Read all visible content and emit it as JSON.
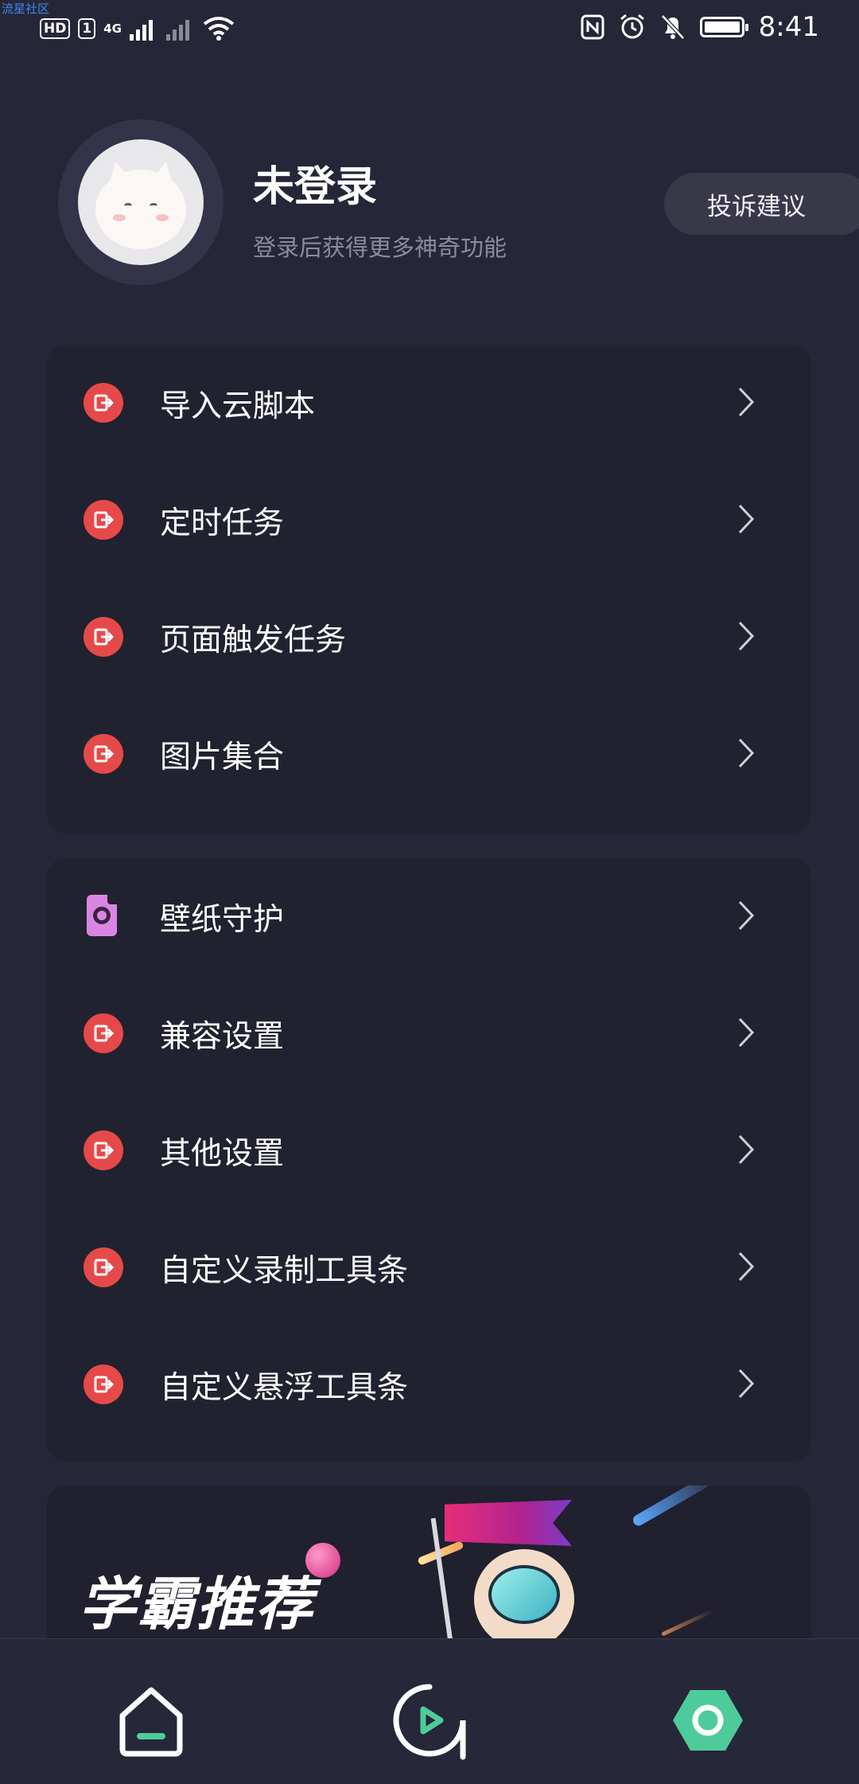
{
  "watermark": "流星社区",
  "status_bar": {
    "left_badges": [
      "HD",
      "1"
    ],
    "network": "4G",
    "time": "8:41",
    "icons": [
      "nfc-icon",
      "alarm-icon",
      "mute-bell-icon",
      "battery-icon"
    ]
  },
  "profile": {
    "name": "未登录",
    "subtitle": "登录后获得更多神奇功能",
    "feedback_button": "投诉建议"
  },
  "menu_group_1": [
    {
      "label": "导入云脚本",
      "icon": "exit-icon"
    },
    {
      "label": "定时任务",
      "icon": "exit-icon"
    },
    {
      "label": "页面触发任务",
      "icon": "exit-icon"
    },
    {
      "label": "图片集合",
      "icon": "exit-icon"
    }
  ],
  "menu_group_2": [
    {
      "label": "壁纸守护",
      "icon": "wallpaper-file-icon"
    },
    {
      "label": "兼容设置",
      "icon": "exit-icon"
    },
    {
      "label": "其他设置",
      "icon": "exit-icon"
    },
    {
      "label": "自定义录制工具条",
      "icon": "exit-icon"
    },
    {
      "label": "自定义悬浮工具条",
      "icon": "exit-icon"
    }
  ],
  "banner": {
    "title": "学霸推荐"
  },
  "bottom_nav": [
    {
      "name": "home",
      "icon": "home-icon"
    },
    {
      "name": "play",
      "icon": "play-circle-icon"
    },
    {
      "name": "settings",
      "icon": "hexagon-settings-icon"
    }
  ],
  "colors": {
    "background": "#262639",
    "card": "#21222f",
    "icon_red": "#e6494a",
    "icon_purple": "#d986e3",
    "accent_green": "#4ecb9a"
  }
}
